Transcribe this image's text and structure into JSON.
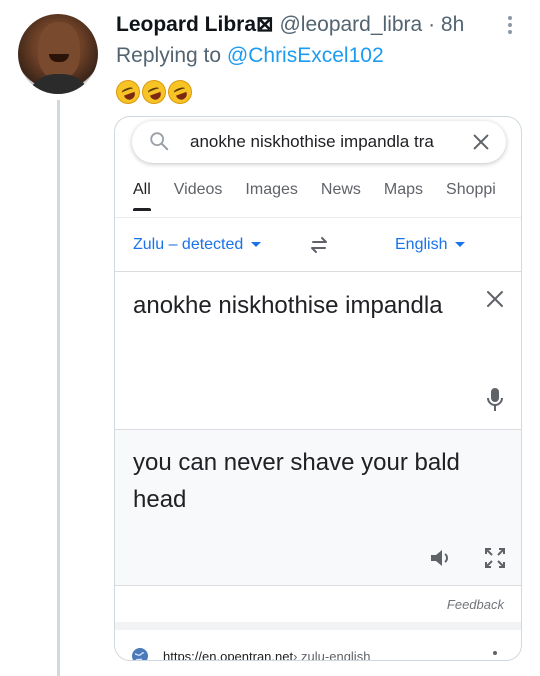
{
  "tweet": {
    "author_name": "Leopard Libra",
    "name_glyph": "⊠",
    "handle": "@leopard_libra",
    "separator": "·",
    "time": "8h",
    "reply_prefix": "Replying to",
    "reply_to": "@ChrisExcel102",
    "reaction_emojis": [
      "rolling-on-floor-laughing",
      "rolling-on-floor-laughing",
      "rolling-on-floor-laughing"
    ]
  },
  "search": {
    "query": "anokhe niskhothise impandla tra",
    "tabs": [
      {
        "label": "All",
        "active": true
      },
      {
        "label": "Videos",
        "active": false
      },
      {
        "label": "Images",
        "active": false
      },
      {
        "label": "News",
        "active": false
      },
      {
        "label": "Maps",
        "active": false
      },
      {
        "label": "Shoppi",
        "active": false
      }
    ]
  },
  "translate": {
    "source_language": "Zulu – detected",
    "target_language": "English",
    "source_text": "anokhe niskhothise impandla",
    "translated_text": "you can never shave your bald head",
    "feedback_label": "Feedback"
  },
  "result": {
    "url": "https://en.opentran.net",
    "crumb": " › zulu-english"
  },
  "colors": {
    "link_blue": "#1d9bf0",
    "google_blue": "#1a73e8",
    "thread_line": "#cfd9de"
  }
}
